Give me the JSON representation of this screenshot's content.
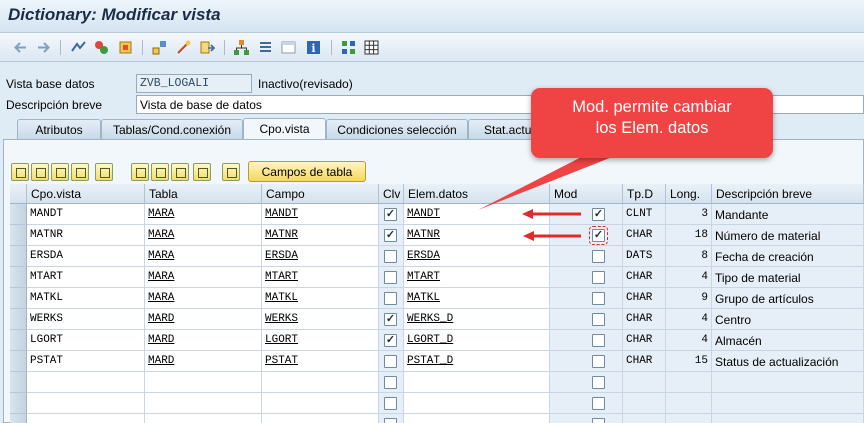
{
  "window": {
    "title": "Dictionary: Modificar vista"
  },
  "toolbar": {
    "icons": [
      "back-arrow-icon",
      "forward-arrow-icon",
      "other-object-icon",
      "display-change-icon",
      "activate-icon",
      "where-used-icon",
      "generate-icon",
      "move-icon",
      "hierarchy-icon",
      "list-icon",
      "frame-icon",
      "info-icon",
      "technical-settings-icon",
      "grid-icon"
    ]
  },
  "header": {
    "base_view_label": "Vista base datos",
    "base_view_value": "ZVB_LOGALI",
    "base_view_status": "Inactivo(revisado)",
    "short_desc_label": "Descripción breve",
    "short_desc_value": "Vista de base de datos"
  },
  "tabs": [
    {
      "label": "Atributos",
      "active": false
    },
    {
      "label": "Tablas/Cond.conexión",
      "active": false
    },
    {
      "label": "Cpo.vista",
      "active": true
    },
    {
      "label": "Condiciones selección",
      "active": false
    },
    {
      "label": "Stat.actu",
      "active": false
    }
  ],
  "panel_toolbar": {
    "campos_button": "Campos de tabla"
  },
  "grid": {
    "columns": [
      "Cpo.vista",
      "Tabla",
      "Campo",
      "Clv",
      "Elem.datos",
      "Mod",
      "Tp.D",
      "Long.",
      "Descripción breve"
    ],
    "rows": [
      {
        "cpo": "MANDT",
        "tabla": "MARA",
        "campo": "MANDT",
        "clv": true,
        "elem": "MANDT",
        "mod": true,
        "tpd": "CLNT",
        "long": "3",
        "desc": "Mandante"
      },
      {
        "cpo": "MATNR",
        "tabla": "MARA",
        "campo": "MATNR",
        "clv": true,
        "elem": "MATNR",
        "mod": true,
        "tpd": "CHAR",
        "long": "18",
        "desc": "Número de material"
      },
      {
        "cpo": "ERSDA",
        "tabla": "MARA",
        "campo": "ERSDA",
        "clv": false,
        "elem": "ERSDA",
        "mod": false,
        "tpd": "DATS",
        "long": "8",
        "desc": "Fecha de creación"
      },
      {
        "cpo": "MTART",
        "tabla": "MARA",
        "campo": "MTART",
        "clv": false,
        "elem": "MTART",
        "mod": false,
        "tpd": "CHAR",
        "long": "4",
        "desc": "Tipo de material"
      },
      {
        "cpo": "MATKL",
        "tabla": "MARA",
        "campo": "MATKL",
        "clv": false,
        "elem": "MATKL",
        "mod": false,
        "tpd": "CHAR",
        "long": "9",
        "desc": "Grupo de artículos"
      },
      {
        "cpo": "WERKS",
        "tabla": "MARD",
        "campo": "WERKS",
        "clv": true,
        "elem": "WERKS_D",
        "mod": false,
        "tpd": "CHAR",
        "long": "4",
        "desc": "Centro"
      },
      {
        "cpo": "LGORT",
        "tabla": "MARD",
        "campo": "LGORT",
        "clv": true,
        "elem": "LGORT_D",
        "mod": false,
        "tpd": "CHAR",
        "long": "4",
        "desc": "Almacén"
      },
      {
        "cpo": "PSTAT",
        "tabla": "MARD",
        "campo": "PSTAT",
        "clv": false,
        "elem": "PSTAT_D",
        "mod": false,
        "tpd": "CHAR",
        "long": "15",
        "desc": "Status de actualización"
      },
      {
        "cpo": "",
        "tabla": "",
        "campo": "",
        "clv": false,
        "elem": "",
        "mod": false,
        "tpd": "",
        "long": "",
        "desc": ""
      },
      {
        "cpo": "",
        "tabla": "",
        "campo": "",
        "clv": false,
        "elem": "",
        "mod": false,
        "tpd": "",
        "long": "",
        "desc": ""
      },
      {
        "cpo": "",
        "tabla": "",
        "campo": "",
        "clv": false,
        "elem": "",
        "mod": false,
        "tpd": "",
        "long": "",
        "desc": ""
      }
    ]
  },
  "annotation": {
    "text_line1": "Mod. permite cambiar",
    "text_line2": "los Elem. datos",
    "color": "#f04344"
  }
}
